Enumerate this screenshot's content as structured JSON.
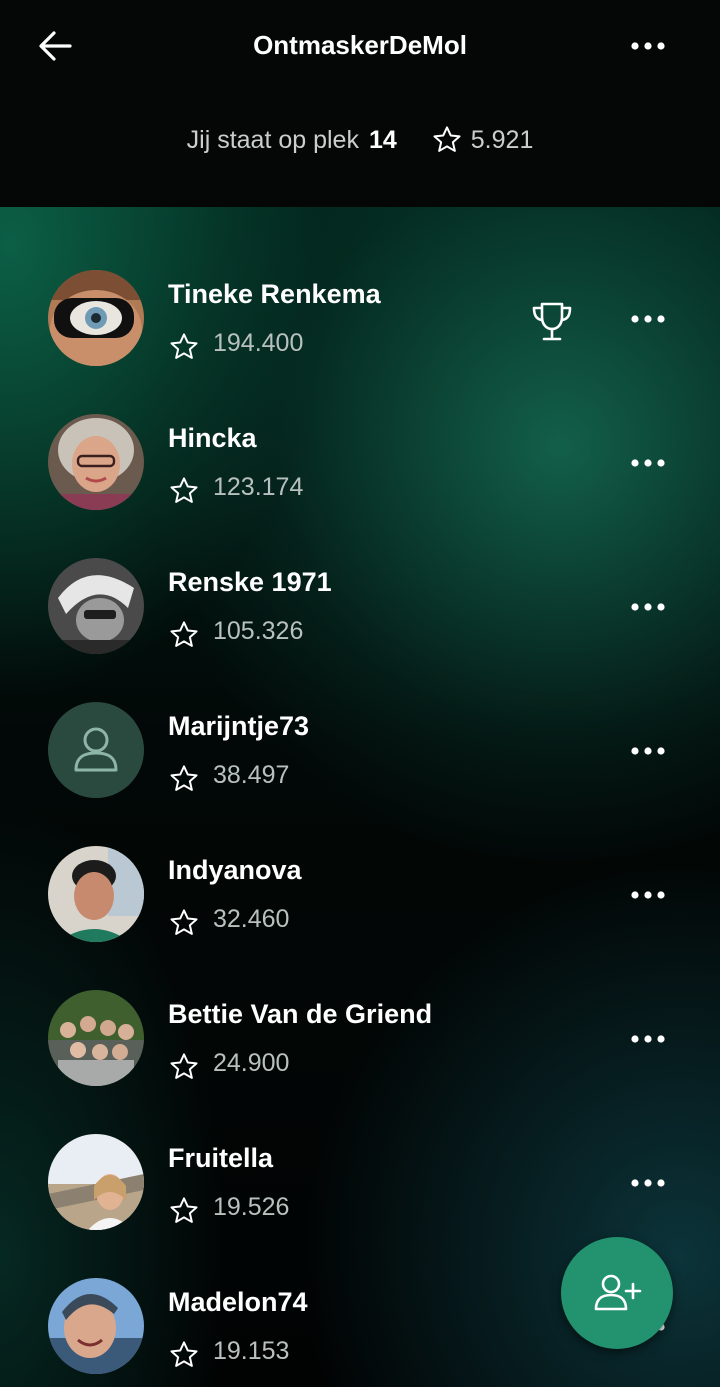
{
  "header": {
    "title": "OntmaskerDeMol",
    "rank_prefix": "Jij staat op plek",
    "rank_value": "14",
    "points": "5.921"
  },
  "icons": {
    "back": "back-arrow-icon",
    "more": "more-dots-icon",
    "star": "star-outline-icon",
    "trophy": "trophy-icon",
    "add_friend": "add-user-icon",
    "default_avatar": "user-outline-icon"
  },
  "colors": {
    "header_bg": "#050706",
    "fab": "#22936e",
    "placeholder_avatar": "#2a4a40",
    "score_text": "#b8c1bd"
  },
  "players": [
    {
      "name": "Tineke Renkema",
      "score": "194.400",
      "trophy": true
    },
    {
      "name": "Hincka",
      "score": "123.174",
      "trophy": false
    },
    {
      "name": "Renske 1971",
      "score": "105.326",
      "trophy": false
    },
    {
      "name": "Marijntje73",
      "score": "38.497",
      "trophy": false
    },
    {
      "name": "Indyanova",
      "score": "32.460",
      "trophy": false
    },
    {
      "name": "Bettie Van de Griend",
      "score": "24.900",
      "trophy": false
    },
    {
      "name": "Fruitella",
      "score": "19.526",
      "trophy": false
    },
    {
      "name": "Madelon74",
      "score": "19.153",
      "trophy": false
    }
  ]
}
